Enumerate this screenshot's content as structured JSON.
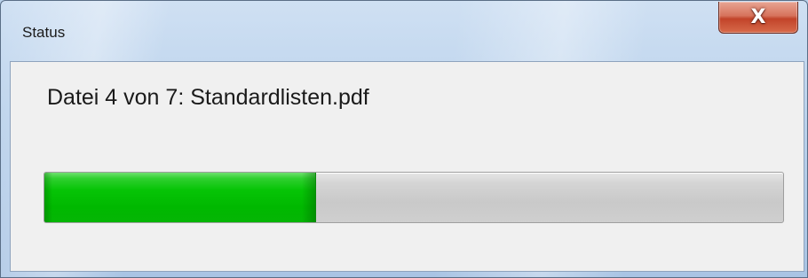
{
  "window": {
    "title": "Status",
    "close_icon_glyph": "X"
  },
  "status": {
    "message": "Datei 4 von 7: Standardlisten.pdf"
  },
  "progress": {
    "fraction": 0.368,
    "fill_color": "#00b800"
  },
  "colors": {
    "frame": "#bcd3ec",
    "client_background": "#f0f0f0",
    "close_button": "#c2442a"
  }
}
